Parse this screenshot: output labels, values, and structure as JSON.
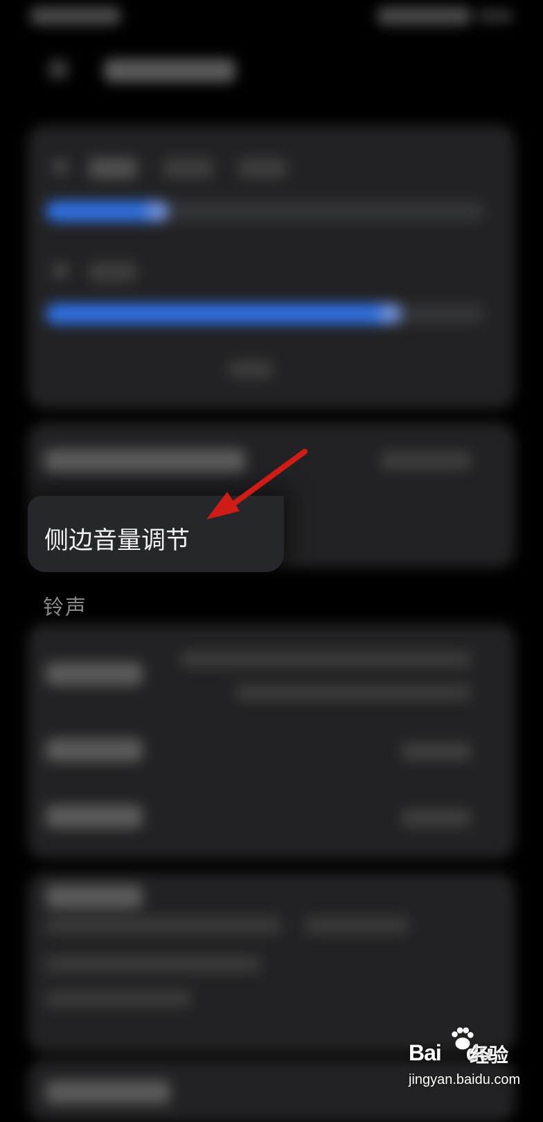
{
  "highlight": {
    "label": "侧边音量调节"
  },
  "ring_section": {
    "heading": "铃声"
  },
  "volume_sliders": [
    {
      "level": 0.28
    },
    {
      "level": 0.81
    }
  ],
  "colors": {
    "background": "#000000",
    "card": "#222224",
    "accent": "#2f6fe0",
    "arrow": "#d01c16",
    "text": "#f2f2f2"
  },
  "annotation": {
    "icon": "red-arrow-icon"
  },
  "watermark": {
    "brand": "Bai",
    "brand_icon": "paw-icon",
    "brand_suffix": "du",
    "cn": "经验",
    "url": "jingyan.baidu.com"
  }
}
